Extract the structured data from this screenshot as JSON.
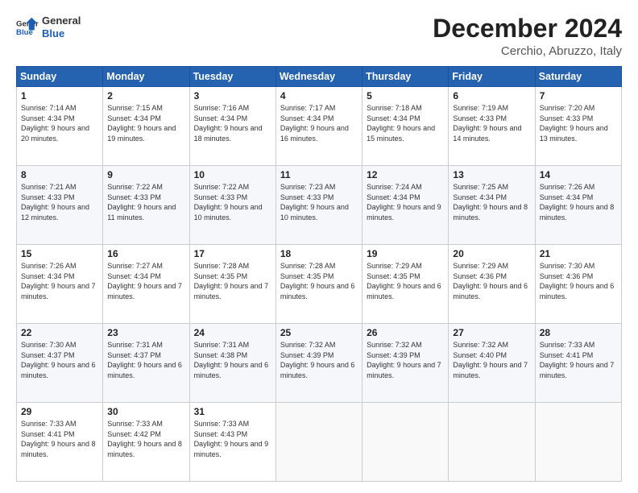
{
  "logo": {
    "line1": "General",
    "line2": "Blue"
  },
  "header": {
    "month": "December 2024",
    "location": "Cerchio, Abruzzo, Italy"
  },
  "days_of_week": [
    "Sunday",
    "Monday",
    "Tuesday",
    "Wednesday",
    "Thursday",
    "Friday",
    "Saturday"
  ],
  "weeks": [
    [
      {
        "day": "1",
        "sunrise": "7:14 AM",
        "sunset": "4:34 PM",
        "daylight": "9 hours and 20 minutes."
      },
      {
        "day": "2",
        "sunrise": "7:15 AM",
        "sunset": "4:34 PM",
        "daylight": "9 hours and 19 minutes."
      },
      {
        "day": "3",
        "sunrise": "7:16 AM",
        "sunset": "4:34 PM",
        "daylight": "9 hours and 18 minutes."
      },
      {
        "day": "4",
        "sunrise": "7:17 AM",
        "sunset": "4:34 PM",
        "daylight": "9 hours and 16 minutes."
      },
      {
        "day": "5",
        "sunrise": "7:18 AM",
        "sunset": "4:34 PM",
        "daylight": "9 hours and 15 minutes."
      },
      {
        "day": "6",
        "sunrise": "7:19 AM",
        "sunset": "4:33 PM",
        "daylight": "9 hours and 14 minutes."
      },
      {
        "day": "7",
        "sunrise": "7:20 AM",
        "sunset": "4:33 PM",
        "daylight": "9 hours and 13 minutes."
      }
    ],
    [
      {
        "day": "8",
        "sunrise": "7:21 AM",
        "sunset": "4:33 PM",
        "daylight": "9 hours and 12 minutes."
      },
      {
        "day": "9",
        "sunrise": "7:22 AM",
        "sunset": "4:33 PM",
        "daylight": "9 hours and 11 minutes."
      },
      {
        "day": "10",
        "sunrise": "7:22 AM",
        "sunset": "4:33 PM",
        "daylight": "9 hours and 10 minutes."
      },
      {
        "day": "11",
        "sunrise": "7:23 AM",
        "sunset": "4:33 PM",
        "daylight": "9 hours and 10 minutes."
      },
      {
        "day": "12",
        "sunrise": "7:24 AM",
        "sunset": "4:34 PM",
        "daylight": "9 hours and 9 minutes."
      },
      {
        "day": "13",
        "sunrise": "7:25 AM",
        "sunset": "4:34 PM",
        "daylight": "9 hours and 8 minutes."
      },
      {
        "day": "14",
        "sunrise": "7:26 AM",
        "sunset": "4:34 PM",
        "daylight": "9 hours and 8 minutes."
      }
    ],
    [
      {
        "day": "15",
        "sunrise": "7:26 AM",
        "sunset": "4:34 PM",
        "daylight": "9 hours and 7 minutes."
      },
      {
        "day": "16",
        "sunrise": "7:27 AM",
        "sunset": "4:34 PM",
        "daylight": "9 hours and 7 minutes."
      },
      {
        "day": "17",
        "sunrise": "7:28 AM",
        "sunset": "4:35 PM",
        "daylight": "9 hours and 7 minutes."
      },
      {
        "day": "18",
        "sunrise": "7:28 AM",
        "sunset": "4:35 PM",
        "daylight": "9 hours and 6 minutes."
      },
      {
        "day": "19",
        "sunrise": "7:29 AM",
        "sunset": "4:35 PM",
        "daylight": "9 hours and 6 minutes."
      },
      {
        "day": "20",
        "sunrise": "7:29 AM",
        "sunset": "4:36 PM",
        "daylight": "9 hours and 6 minutes."
      },
      {
        "day": "21",
        "sunrise": "7:30 AM",
        "sunset": "4:36 PM",
        "daylight": "9 hours and 6 minutes."
      }
    ],
    [
      {
        "day": "22",
        "sunrise": "7:30 AM",
        "sunset": "4:37 PM",
        "daylight": "9 hours and 6 minutes."
      },
      {
        "day": "23",
        "sunrise": "7:31 AM",
        "sunset": "4:37 PM",
        "daylight": "9 hours and 6 minutes."
      },
      {
        "day": "24",
        "sunrise": "7:31 AM",
        "sunset": "4:38 PM",
        "daylight": "9 hours and 6 minutes."
      },
      {
        "day": "25",
        "sunrise": "7:32 AM",
        "sunset": "4:39 PM",
        "daylight": "9 hours and 6 minutes."
      },
      {
        "day": "26",
        "sunrise": "7:32 AM",
        "sunset": "4:39 PM",
        "daylight": "9 hours and 7 minutes."
      },
      {
        "day": "27",
        "sunrise": "7:32 AM",
        "sunset": "4:40 PM",
        "daylight": "9 hours and 7 minutes."
      },
      {
        "day": "28",
        "sunrise": "7:33 AM",
        "sunset": "4:41 PM",
        "daylight": "9 hours and 7 minutes."
      }
    ],
    [
      {
        "day": "29",
        "sunrise": "7:33 AM",
        "sunset": "4:41 PM",
        "daylight": "9 hours and 8 minutes."
      },
      {
        "day": "30",
        "sunrise": "7:33 AM",
        "sunset": "4:42 PM",
        "daylight": "9 hours and 8 minutes."
      },
      {
        "day": "31",
        "sunrise": "7:33 AM",
        "sunset": "4:43 PM",
        "daylight": "9 hours and 9 minutes."
      },
      null,
      null,
      null,
      null
    ]
  ],
  "labels": {
    "sunrise": "Sunrise:",
    "sunset": "Sunset:",
    "daylight": "Daylight:"
  }
}
